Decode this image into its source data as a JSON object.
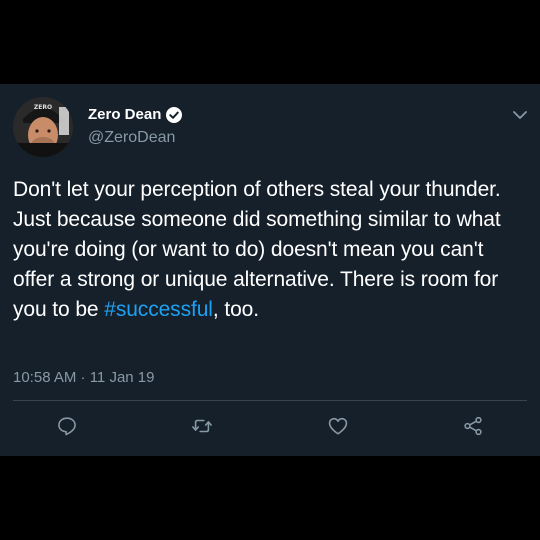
{
  "user": {
    "display_name": "Zero Dean",
    "handle": "@ZeroDean",
    "verified": true,
    "avatar_cap_text": "ZERO"
  },
  "tweet": {
    "text_part1": "Don't let your perception of others steal your thunder. Just because someone did something similar to what you're doing (or want to do) doesn't mean you can't offer a strong or unique alternative. There is room for you to be ",
    "hashtag": "#successful",
    "text_part2": ", too.",
    "timestamp": "10:58 AM · 11 Jan 19"
  },
  "icons": {
    "menu": "chevron-down-icon",
    "reply": "comment-icon",
    "retweet": "retweet-icon",
    "like": "heart-icon",
    "share": "share-icon"
  },
  "colors": {
    "background": "#15202b",
    "text": "#ffffff",
    "secondary": "#8899a6",
    "accent": "#1da1f2"
  }
}
